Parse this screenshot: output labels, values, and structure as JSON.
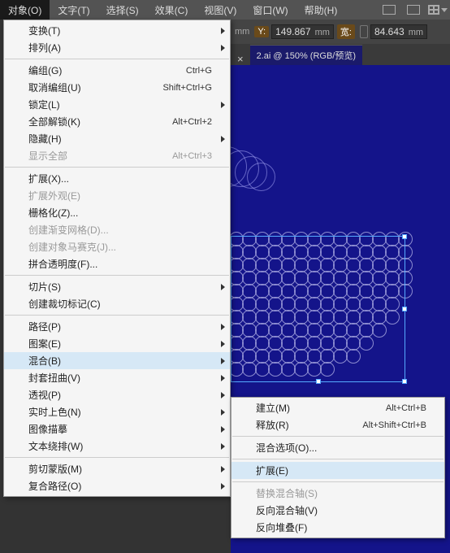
{
  "menubar": {
    "items": [
      {
        "label": "对象(O)",
        "active": true
      },
      {
        "label": "文字(T)"
      },
      {
        "label": "选择(S)"
      },
      {
        "label": "效果(C)"
      },
      {
        "label": "视图(V)"
      },
      {
        "label": "窗口(W)"
      },
      {
        "label": "帮助(H)"
      }
    ]
  },
  "toolbar": {
    "x_unit": "mm",
    "y_label": "Y:",
    "y_value": "149.867",
    "y_unit": "mm",
    "w_label": "宽:",
    "w_value": "84.643",
    "w_unit": "mm"
  },
  "tab": {
    "close": "×",
    "title": "2.ai @ 150% (RGB/预览)"
  },
  "menu": [
    {
      "type": "item",
      "label": "变换(T)",
      "arrow": true
    },
    {
      "type": "item",
      "label": "排列(A)",
      "arrow": true
    },
    {
      "type": "sep"
    },
    {
      "type": "item",
      "label": "编组(G)",
      "sc": "Ctrl+G"
    },
    {
      "type": "item",
      "label": "取消编组(U)",
      "sc": "Shift+Ctrl+G"
    },
    {
      "type": "item",
      "label": "锁定(L)",
      "arrow": true
    },
    {
      "type": "item",
      "label": "全部解锁(K)",
      "sc": "Alt+Ctrl+2"
    },
    {
      "type": "item",
      "label": "隐藏(H)",
      "arrow": true
    },
    {
      "type": "item",
      "label": "显示全部",
      "sc": "Alt+Ctrl+3",
      "disabled": true
    },
    {
      "type": "sep"
    },
    {
      "type": "item",
      "label": "扩展(X)..."
    },
    {
      "type": "item",
      "label": "扩展外观(E)",
      "disabled": true
    },
    {
      "type": "item",
      "label": "栅格化(Z)..."
    },
    {
      "type": "item",
      "label": "创建渐变网格(D)...",
      "disabled": true
    },
    {
      "type": "item",
      "label": "创建对象马赛克(J)...",
      "disabled": true
    },
    {
      "type": "item",
      "label": "拼合透明度(F)..."
    },
    {
      "type": "sep"
    },
    {
      "type": "item",
      "label": "切片(S)",
      "arrow": true
    },
    {
      "type": "item",
      "label": "创建裁切标记(C)"
    },
    {
      "type": "sep"
    },
    {
      "type": "item",
      "label": "路径(P)",
      "arrow": true
    },
    {
      "type": "item",
      "label": "图案(E)",
      "arrow": true
    },
    {
      "type": "item",
      "label": "混合(B)",
      "arrow": true,
      "hl": true
    },
    {
      "type": "item",
      "label": "封套扭曲(V)",
      "arrow": true
    },
    {
      "type": "item",
      "label": "透视(P)",
      "arrow": true
    },
    {
      "type": "item",
      "label": "实时上色(N)",
      "arrow": true
    },
    {
      "type": "item",
      "label": "图像描摹",
      "arrow": true
    },
    {
      "type": "item",
      "label": "文本绕排(W)",
      "arrow": true
    },
    {
      "type": "sep"
    },
    {
      "type": "item",
      "label": "剪切蒙版(M)",
      "arrow": true
    },
    {
      "type": "item",
      "label": "复合路径(O)",
      "arrow": true
    }
  ],
  "submenu": [
    {
      "type": "item",
      "label": "建立(M)",
      "sc": "Alt+Ctrl+B"
    },
    {
      "type": "item",
      "label": "释放(R)",
      "sc": "Alt+Shift+Ctrl+B"
    },
    {
      "type": "sep"
    },
    {
      "type": "item",
      "label": "混合选项(O)..."
    },
    {
      "type": "sep"
    },
    {
      "type": "item",
      "label": "扩展(E)",
      "hl": true
    },
    {
      "type": "sep"
    },
    {
      "type": "item",
      "label": "替换混合轴(S)",
      "disabled": true
    },
    {
      "type": "item",
      "label": "反向混合轴(V)"
    },
    {
      "type": "item",
      "label": "反向堆叠(F)"
    }
  ]
}
